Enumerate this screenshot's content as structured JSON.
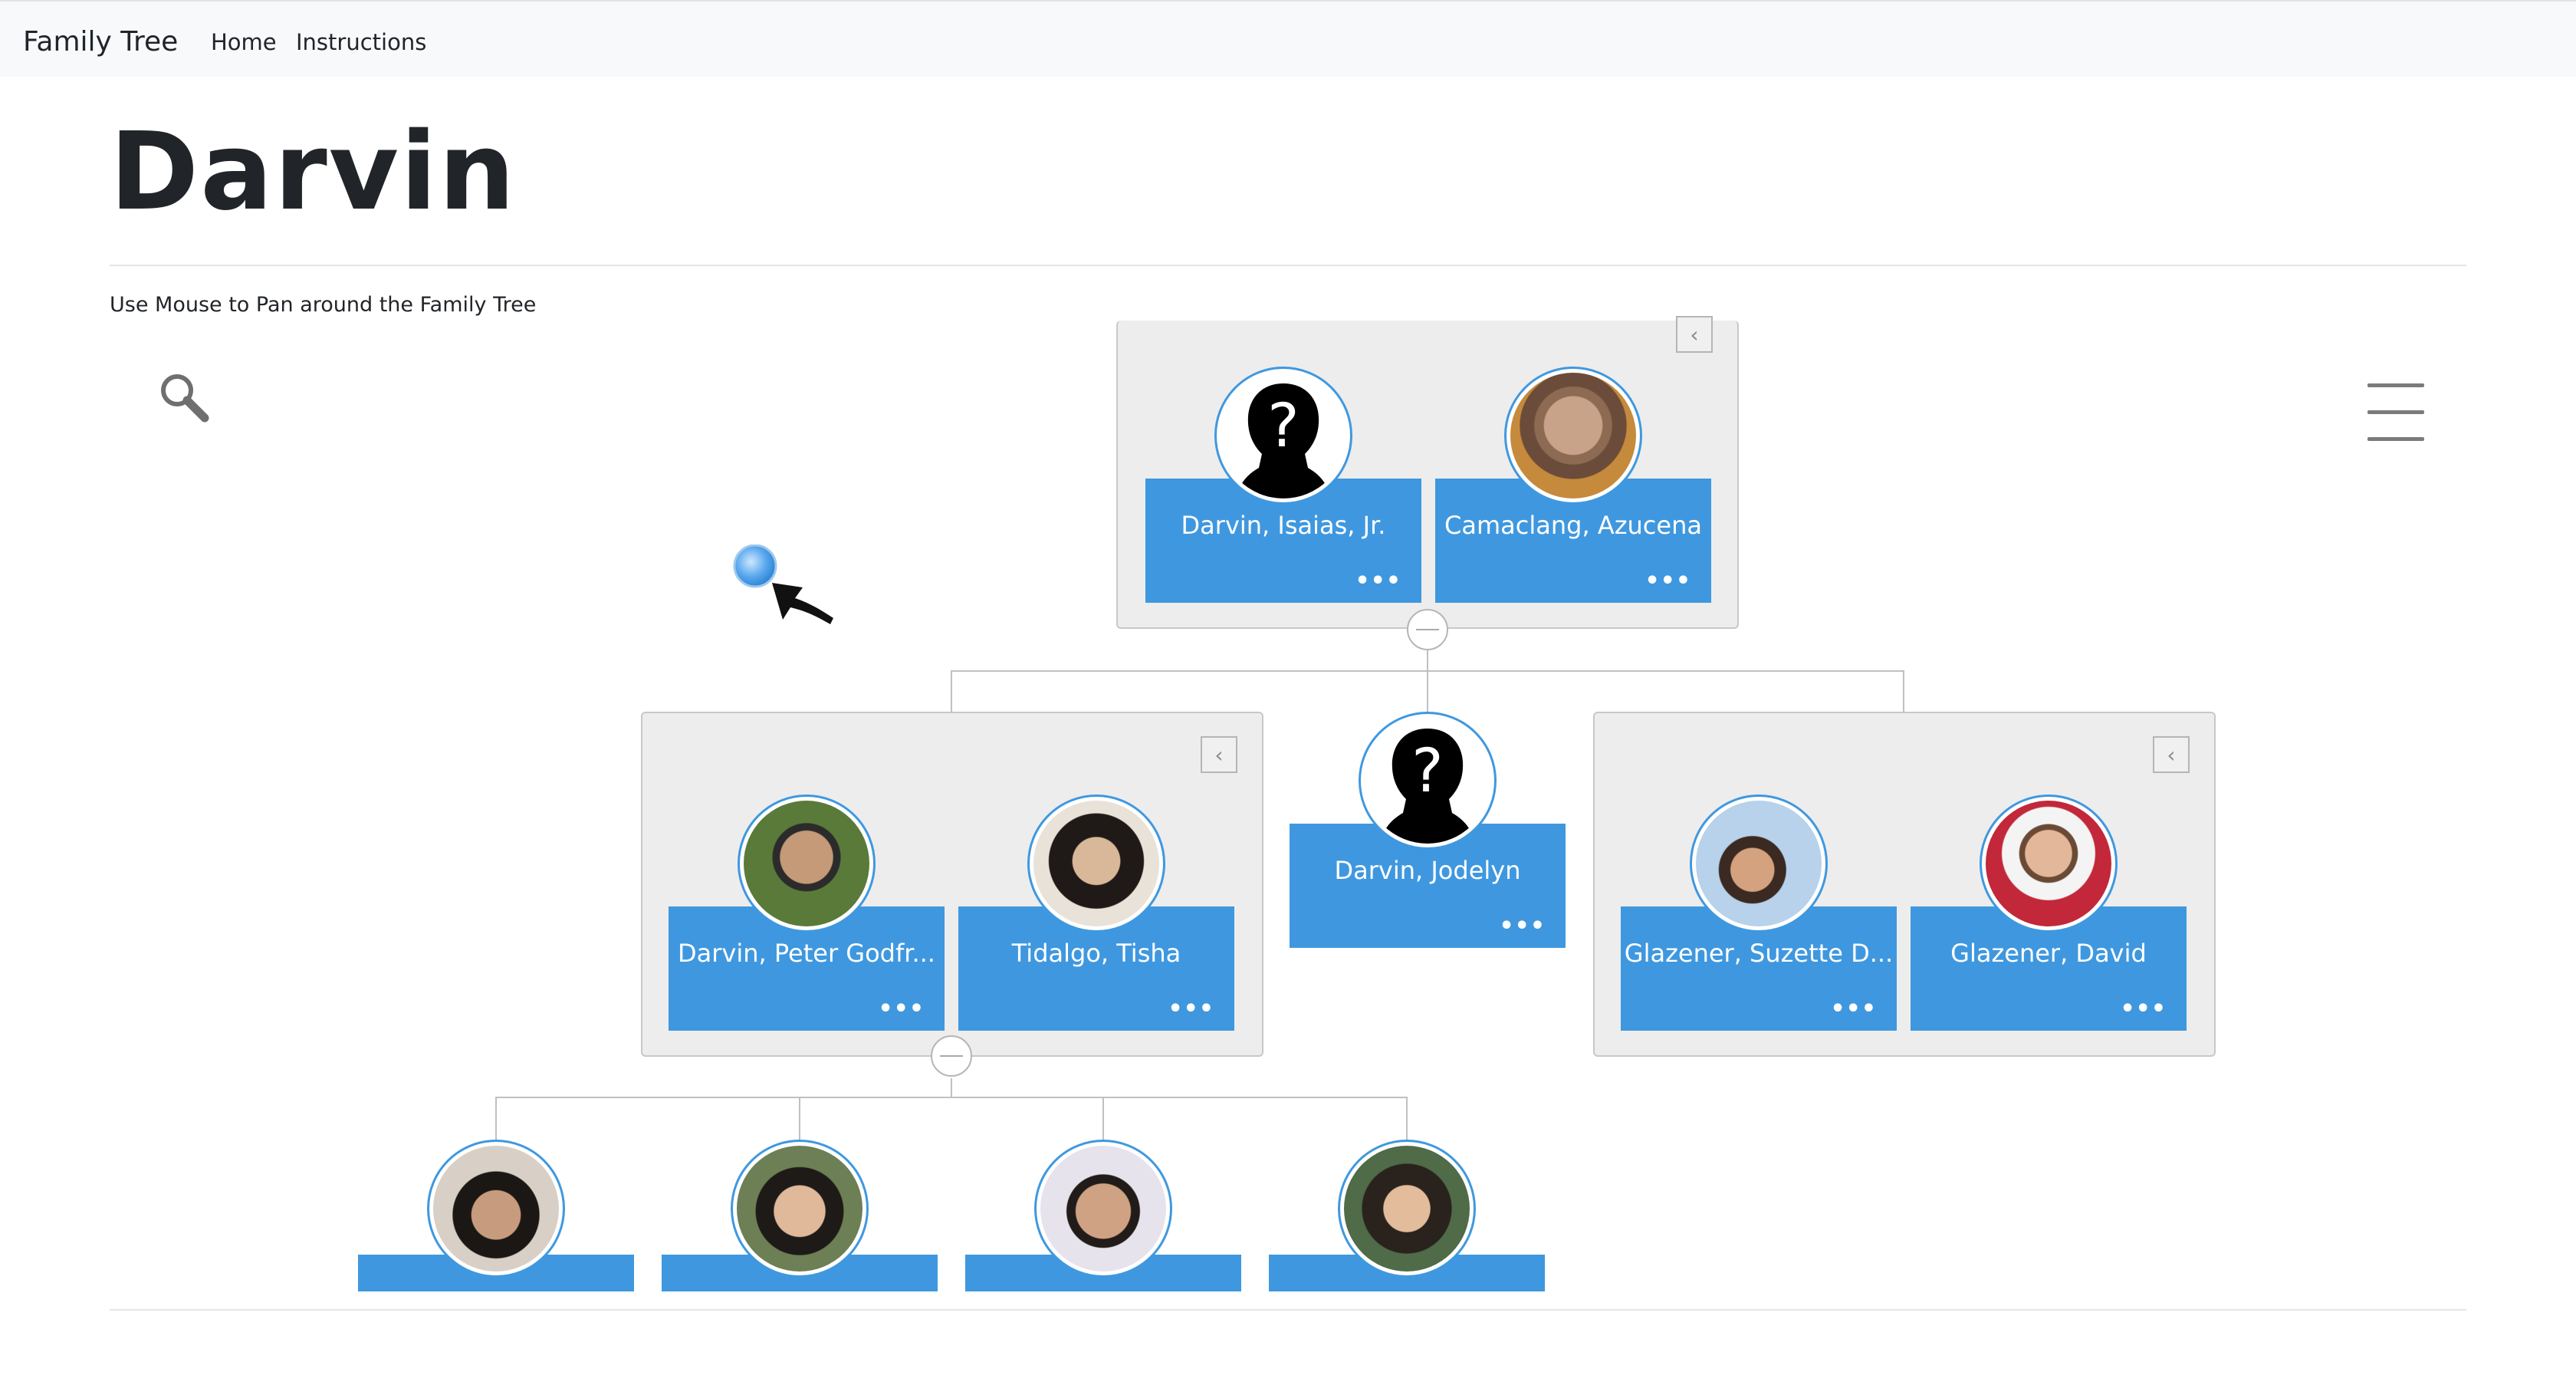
{
  "navbar": {
    "brand": "Family Tree",
    "links": [
      "Home",
      "Instructions"
    ]
  },
  "page": {
    "title": "Darvin",
    "hint": "Use Mouse to Pan around the Family Tree"
  },
  "toolbar": {
    "search_icon": "search-icon",
    "menu_icon": "hamburger-menu-icon"
  },
  "tree": {
    "parents": [
      {
        "name": "Darvin, Isaias, Jr.",
        "photo": "unknown-silhouette",
        "more": "•••"
      },
      {
        "name": "Camaclang, Azucena",
        "photo": "photo",
        "more": "•••"
      }
    ],
    "children_generation": [
      {
        "name": "Darvin, Peter Godfr...",
        "photo": "photo",
        "more": "•••"
      },
      {
        "name": "Tidalgo, Tisha",
        "photo": "photo",
        "more": "•••"
      },
      {
        "name": "Darvin, Jodelyn",
        "photo": "unknown-silhouette",
        "more": "•••"
      },
      {
        "name": "Glazener, Suzette D...",
        "photo": "photo",
        "more": "•••"
      },
      {
        "name": "Glazener, David",
        "photo": "photo",
        "more": "•••"
      }
    ],
    "grandchildren": [
      {
        "photo": "photo"
      },
      {
        "photo": "photo"
      },
      {
        "photo": "photo"
      },
      {
        "photo": "photo"
      }
    ]
  },
  "colors": {
    "card_blue": "#3f98df",
    "family_box_bg": "#ededed",
    "navbar_bg": "#f8f9fa"
  }
}
